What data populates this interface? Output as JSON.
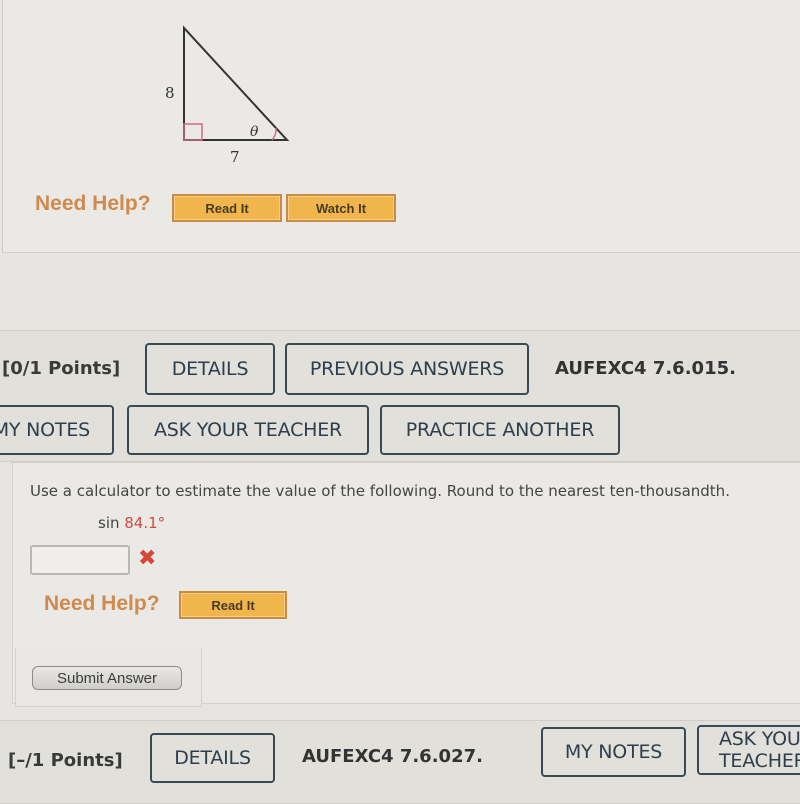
{
  "previous_problem": {
    "figure": {
      "vertical_leg_label": "8",
      "horizontal_leg_label": "7",
      "angle_label": "θ",
      "right_angle_color": "#d06a8a"
    },
    "need_help_label": "Need Help?",
    "read_it_label": "Read It",
    "watch_it_label": "Watch It"
  },
  "current_problem": {
    "points": "[0/1 Points]",
    "details_label": "DETAILS",
    "previous_answers_label": "PREVIOUS ANSWERS",
    "code": "AUFEXC4 7.6.015.",
    "my_notes_label": "MY NOTES",
    "ask_teacher_label": "ASK YOUR TEACHER",
    "practice_another_label": "PRACTICE ANOTHER",
    "instruction": "Use a calculator to estimate the value of the following. Round to the nearest ten-thousandth.",
    "expression_prefix": "sin ",
    "expression_value": "84.1°",
    "answer_value": "",
    "answer_status": "incorrect",
    "incorrect_mark": "✖",
    "need_help_label": "Need Help?",
    "read_it_label": "Read It",
    "submit_label": "Submit Answer"
  },
  "next_problem": {
    "points": "[–/1 Points]",
    "details_label": "DETAILS",
    "code": "AUFEXC4 7.6.027.",
    "my_notes_label": "MY NOTES",
    "ask_teacher_label": "ASK YOUR TEACHER"
  },
  "colors": {
    "need_help": "#d08a4e",
    "help_button": "#f0b64c",
    "outline_button": "#2f3e4c",
    "incorrect": "#d8453a",
    "highlight_value": "#d24a3e"
  }
}
